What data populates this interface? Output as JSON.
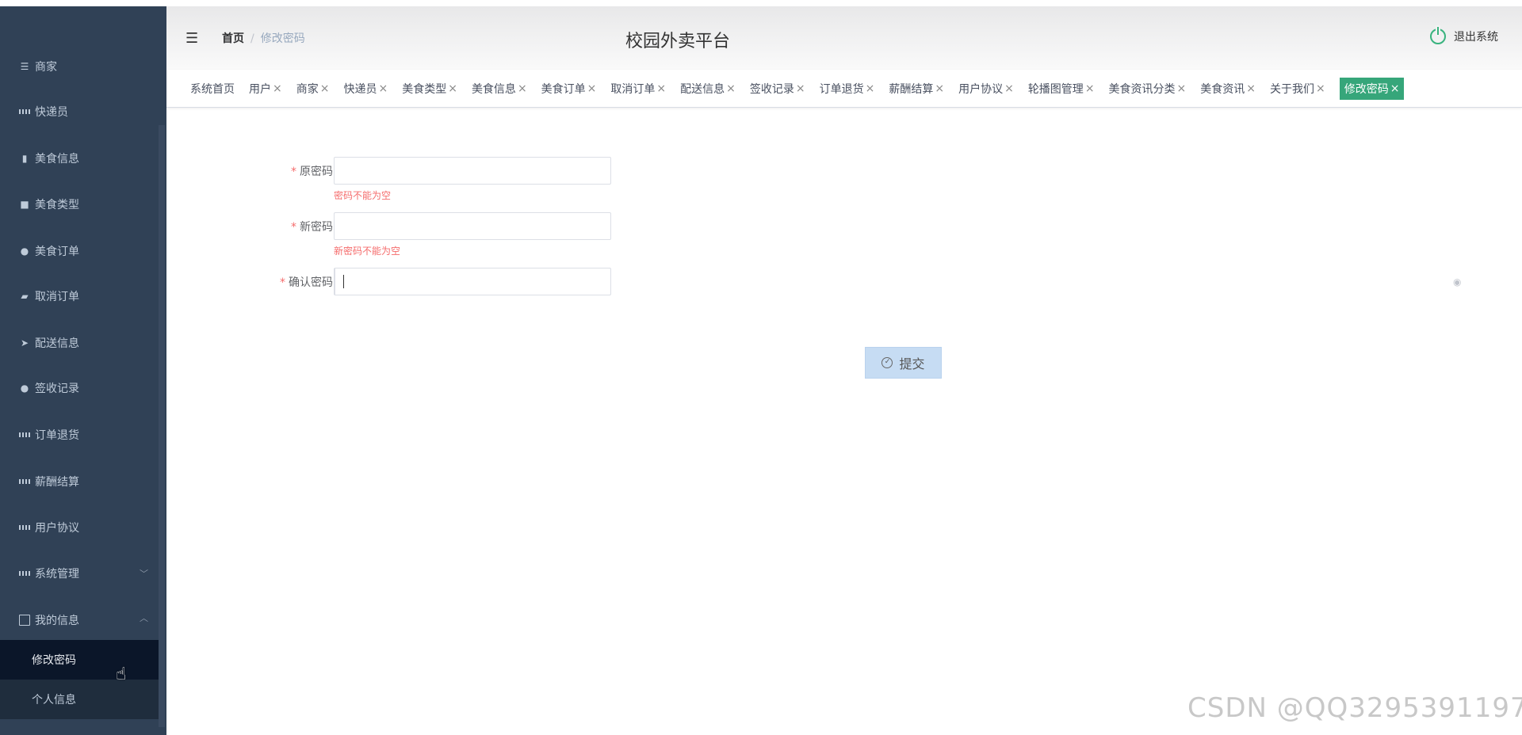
{
  "app": {
    "title": "校园外卖平台",
    "logout": "退出系统"
  },
  "breadcrumb": {
    "home": "首页",
    "separator": "/",
    "current": "修改密码"
  },
  "sidebar": {
    "items": [
      {
        "label": "商家",
        "icon": "sliders-icon"
      },
      {
        "label": "快递员",
        "icon": "grid-icon"
      },
      {
        "label": "美食信息",
        "icon": "bar-chart-icon"
      },
      {
        "label": "美食类型",
        "icon": "briefcase-icon"
      },
      {
        "label": "美食订单",
        "icon": "user-icon"
      },
      {
        "label": "取消订单",
        "icon": "thumbs-icon"
      },
      {
        "label": "配送信息",
        "icon": "send-icon"
      },
      {
        "label": "签收记录",
        "icon": "bulb-icon"
      },
      {
        "label": "订单退货",
        "icon": "grid-icon"
      },
      {
        "label": "薪酬结算",
        "icon": "grid-icon"
      },
      {
        "label": "用户协议",
        "icon": "grid-icon"
      },
      {
        "label": "系统管理",
        "icon": "grid-icon"
      },
      {
        "label": "我的信息",
        "icon": "card-icon"
      }
    ],
    "submenu": [
      {
        "label": "修改密码",
        "active": true
      },
      {
        "label": "个人信息",
        "active": false
      }
    ]
  },
  "tabs": [
    {
      "label": "系统首页",
      "closable": false
    },
    {
      "label": "用户",
      "closable": true
    },
    {
      "label": "商家",
      "closable": true
    },
    {
      "label": "快递员",
      "closable": true
    },
    {
      "label": "美食类型",
      "closable": true
    },
    {
      "label": "美食信息",
      "closable": true
    },
    {
      "label": "美食订单",
      "closable": true
    },
    {
      "label": "取消订单",
      "closable": true
    },
    {
      "label": "配送信息",
      "closable": true
    },
    {
      "label": "签收记录",
      "closable": true
    },
    {
      "label": "订单退货",
      "closable": true
    },
    {
      "label": "薪酬结算",
      "closable": true
    },
    {
      "label": "用户协议",
      "closable": true
    },
    {
      "label": "轮播图管理",
      "closable": true
    },
    {
      "label": "美食资讯分类",
      "closable": true
    },
    {
      "label": "美食资讯",
      "closable": true
    },
    {
      "label": "关于我们",
      "closable": true
    },
    {
      "label": "修改密码",
      "closable": true,
      "active": true
    }
  ],
  "tab_close": "×",
  "form": {
    "required_mark": "*",
    "fields": [
      {
        "label": "原密码",
        "value": "",
        "error": "密码不能为空"
      },
      {
        "label": "新密码",
        "value": "",
        "error": "新密码不能为空"
      },
      {
        "label": "确认密码",
        "value": "",
        "error": ""
      }
    ],
    "submit": "提交"
  },
  "colors": {
    "sidebar": "#304156",
    "accent": "#36a67a",
    "error": "#f56c6c",
    "submit_bg": "#c6dcf3"
  },
  "watermark": "CSDN @QQ3295391197"
}
